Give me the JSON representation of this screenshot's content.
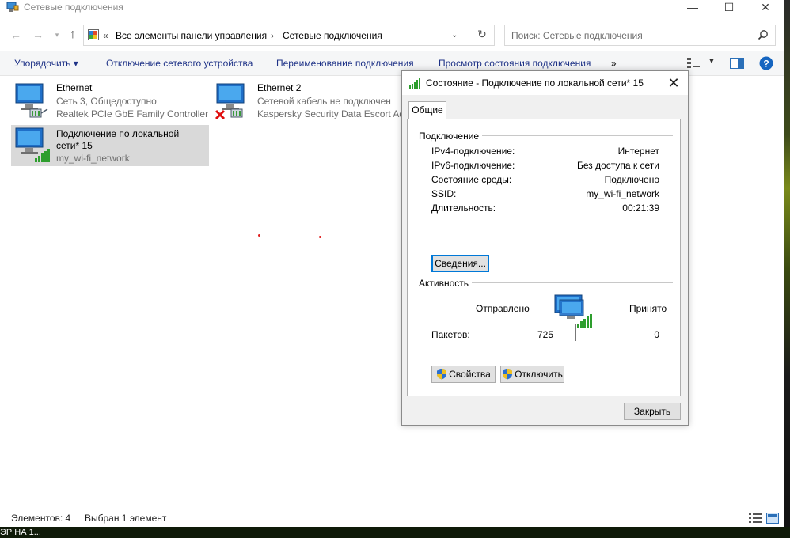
{
  "window": {
    "title": "Сетевые подключения"
  },
  "addressbar": {
    "overflow": "«",
    "parts": [
      "Все элементы панели управления",
      "Сетевые подключения"
    ],
    "search_placeholder": "Поиск: Сетевые подключения"
  },
  "toolbar": {
    "organize": "Упорядочить ▾",
    "disable": "Отключение сетевого устройства",
    "rename": "Переименование подключения",
    "view_status": "Просмотр состояния подключения",
    "more": "»"
  },
  "connections": [
    {
      "name": "Ethernet",
      "line2": "Сеть 3, Общедоступно",
      "line3": "Realtek PCIe GbE Family Controller"
    },
    {
      "name": "Ethernet 2",
      "line2": "Сетевой кабель не подключен",
      "line3": "Kaspersky Security Data Escort Ad..."
    },
    {
      "name_line1": "Подключение по локальной",
      "name_line2": "сети* 15",
      "line3": "my_wi-fi_network"
    }
  ],
  "statusbar": {
    "elements": "Элементов: 4",
    "selected": "Выбран 1 элемент"
  },
  "taskbar": {
    "text": "ЭР НА 1..."
  },
  "dialog": {
    "title": "Состояние - Подключение по локальной сети* 15",
    "tab": "Общие",
    "connection_group": "Подключение",
    "rows": [
      {
        "label": "IPv4-подключение:",
        "value": "Интернет"
      },
      {
        "label": "IPv6-подключение:",
        "value": "Без доступа к сети"
      },
      {
        "label": "Состояние среды:",
        "value": "Подключено"
      },
      {
        "label": "SSID:",
        "value": "my_wi-fi_network"
      },
      {
        "label": "Длительность:",
        "value": "00:21:39"
      }
    ],
    "details_button": "Сведения...",
    "activity_group": "Активность",
    "sent_label": "Отправлено",
    "received_label": "Принято",
    "packets_label": "Пакетов:",
    "packets_sent": "725",
    "packets_received": "0",
    "properties_button": "Свойства",
    "disable_button": "Отключить",
    "close_button": "Закрыть"
  },
  "colors": {
    "accent": "#0078d7",
    "link": "#1e3287",
    "signal": "#2e9e2e",
    "error": "#e01010"
  }
}
